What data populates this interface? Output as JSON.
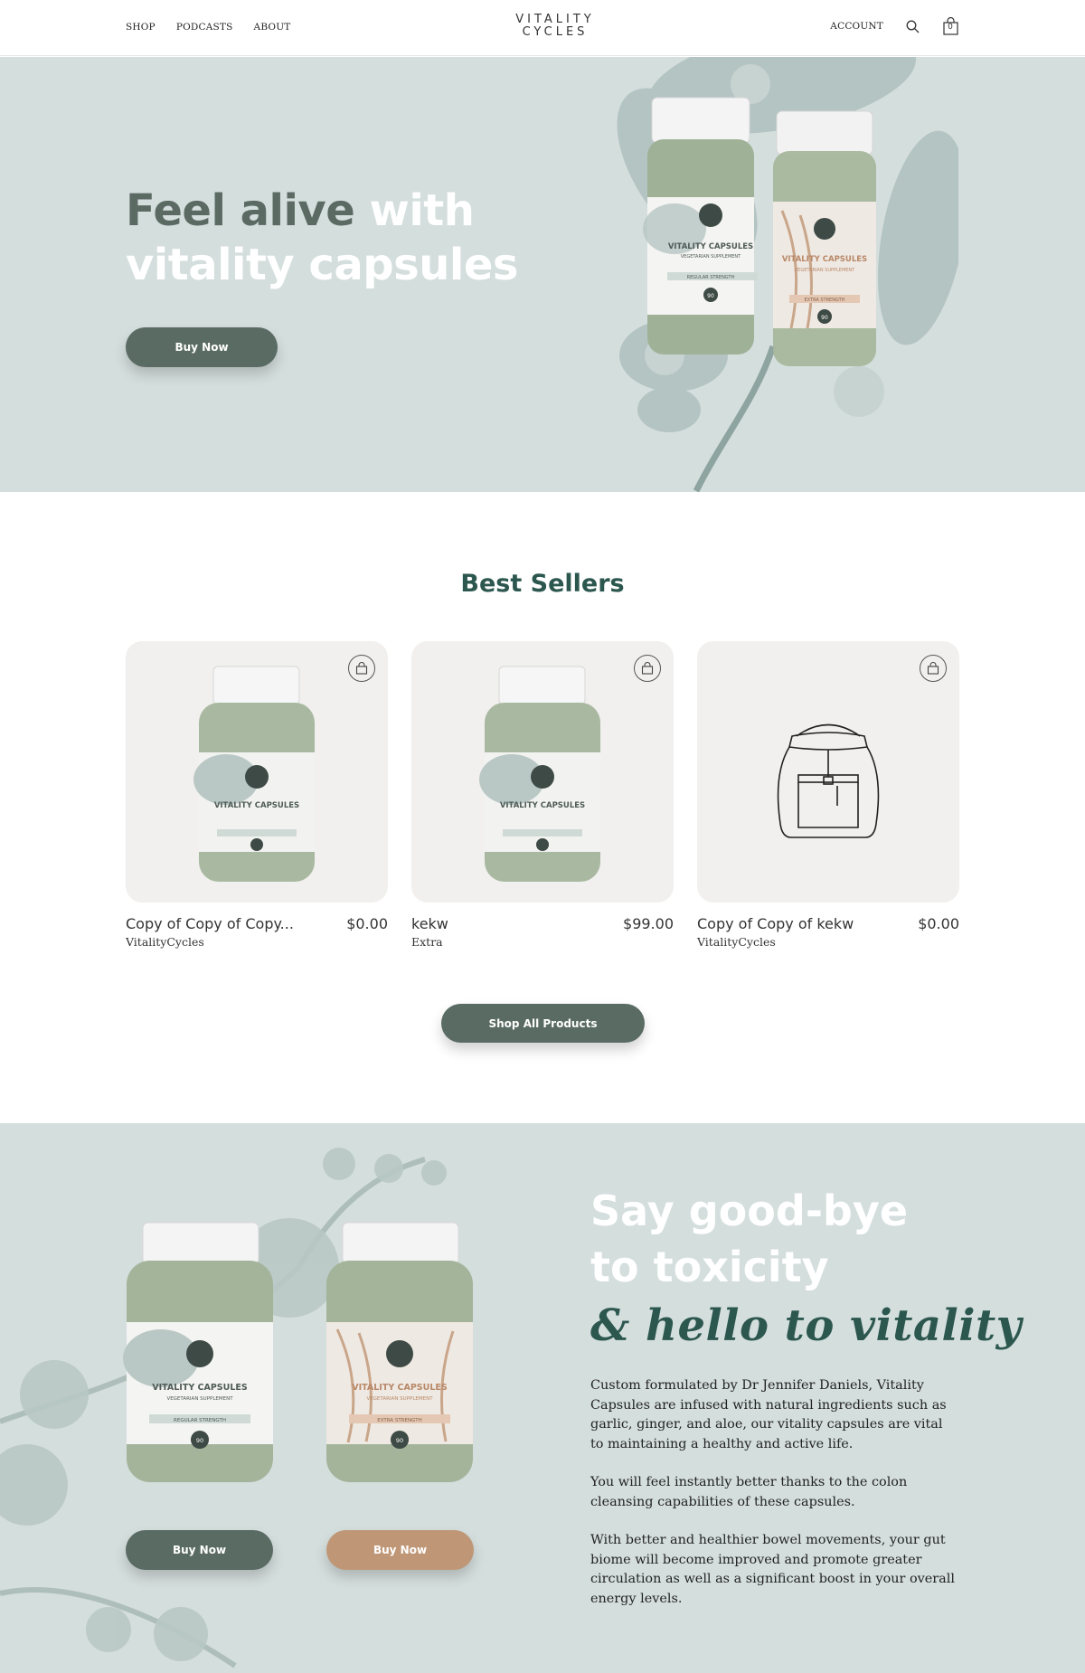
{
  "header": {
    "nav": [
      "SHOP",
      "PODCASTS",
      "ABOUT"
    ],
    "logo_line1": "VITALITY",
    "logo_line2": "CYCLES",
    "account_label": "ACCOUNT",
    "cart_count": "0"
  },
  "hero": {
    "title_dark": "Feel alive",
    "title_light": "with vitality capsules",
    "button_label": "Buy Now"
  },
  "best_sellers": {
    "title": "Best Sellers",
    "products": [
      {
        "name": "Copy of Copy of Copy...",
        "price": "$0.00",
        "vendor": "VitalityCycles",
        "image": "vitality-capsules-jar"
      },
      {
        "name": "kekw",
        "price": "$99.00",
        "vendor": "Extra",
        "image": "vitality-capsules-jar"
      },
      {
        "name": "Copy of Copy of kekw",
        "price": "$0.00",
        "vendor": "VitalityCycles",
        "image": "backpack-icon"
      }
    ],
    "shop_all_label": "Shop All Products"
  },
  "promo": {
    "title": "Say good-bye to toxicity",
    "script": "& hello to vitality",
    "paragraphs": [
      "Custom formulated by Dr Jennifer Daniels, Vitality Capsules are infused with natural ingredients such as garlic, ginger, and aloe, our vitality capsules are vital to maintaining a healthy and active life.",
      "You will feel instantly better thanks to the colon cleansing capabilities of these capsules.",
      "With better and healthier bowel movements, your gut biome will become improved and promote greater circulation as well as a significant boost in your overall energy levels."
    ],
    "button1_label": "Buy Now",
    "button2_label": "Buy Now"
  },
  "jar_labels": {
    "brand": "VITALITY CAPSULES",
    "subtitle": "VEGETARIAN SUPPLEMENT",
    "regular": "REGULAR STRENGTH",
    "extra": "EXTRA STRENGTH",
    "count": "90"
  },
  "colors": {
    "sage_bg": "#d4dedd",
    "button_dark": "#5a6b64",
    "button_tan": "#bf9777",
    "accent_green": "#2c574f"
  }
}
